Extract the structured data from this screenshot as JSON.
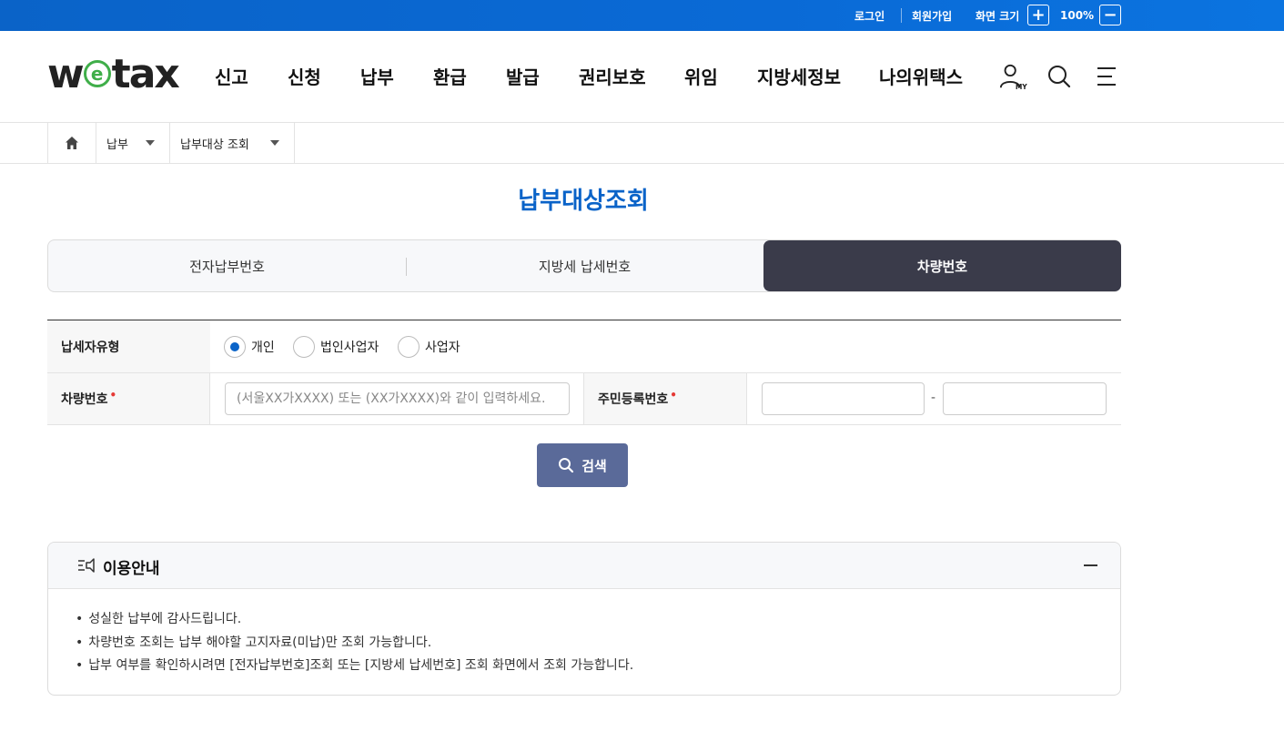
{
  "topbar": {
    "login": "로그인",
    "join": "회원가입",
    "zoom_label": "화면 크기",
    "zoom_in": "+",
    "zoom_value": "100%",
    "zoom_out": "−"
  },
  "header": {
    "logo_w": "w",
    "logo_e": "e",
    "logo_tax": "tax",
    "nav": [
      "신고",
      "신청",
      "납부",
      "환급",
      "발급",
      "권리보호",
      "위임",
      "지방세정보",
      "나의위택스"
    ],
    "my_icon_label": "MY"
  },
  "breadcrumb": {
    "level1": "납부",
    "level2": "납부대상 조회"
  },
  "page": {
    "title": "납부대상조회"
  },
  "tabs": [
    {
      "label": "전자납부번호",
      "active": false
    },
    {
      "label": "지방세 납세번호",
      "active": false
    },
    {
      "label": "차량번호",
      "active": true
    }
  ],
  "form": {
    "taxpayer_type_label": "납세자유형",
    "taxpayer_types": [
      {
        "label": "개인",
        "selected": true
      },
      {
        "label": "법인사업자",
        "selected": false
      },
      {
        "label": "사업자",
        "selected": false
      }
    ],
    "vehicle_label": "차량번호",
    "required_mark": "•",
    "vehicle_placeholder": "(서울XX가XXXX) 또는 (XX가XXXX)와 같이 입력하세요.",
    "vehicle_value": "",
    "rrn_label": "주민등록번호",
    "rrn_front_value": "",
    "rrn_separator": "-",
    "rrn_back_value": ""
  },
  "search": {
    "label": "검색"
  },
  "guide": {
    "title": "이용안내",
    "items": [
      "성실한 납부에 감사드립니다.",
      "차량번호 조회는 납부 해야할 고지자료(미납)만 조회 가능합니다.",
      "납부 여부를 확인하시려면 [전자납부번호]조회 또는 [지방세 납세번호] 조회 화면에서 조회 가능합니다."
    ]
  },
  "colors": {
    "brand_blue": "#0a63c8",
    "active_tab": "#3a3b4a",
    "search_button": "#5a6a99",
    "required": "#e53935",
    "logo_green": "#3fae49"
  }
}
